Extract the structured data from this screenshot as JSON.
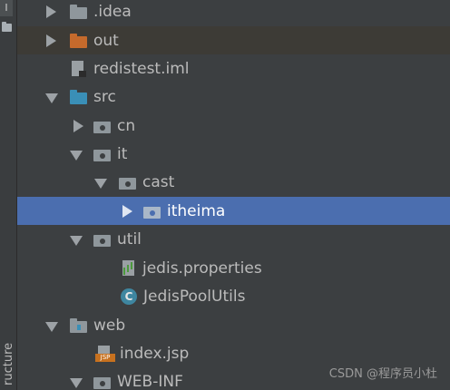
{
  "side": {
    "top_label": "I",
    "structure_tab": "ructure"
  },
  "tree": {
    "items": [
      {
        "label": ".idea"
      },
      {
        "label": "out"
      },
      {
        "label": "redistest.iml"
      },
      {
        "label": "src"
      },
      {
        "label": "cn"
      },
      {
        "label": "it"
      },
      {
        "label": "cast"
      },
      {
        "label": "itheima"
      },
      {
        "label": "util"
      },
      {
        "label": "jedis.properties"
      },
      {
        "label": "JedisPoolUtils"
      },
      {
        "label": "web"
      },
      {
        "label": "index.jsp"
      },
      {
        "label": "WEB-INF"
      }
    ]
  },
  "icons": {
    "class_letter": "C",
    "jsp_badge": "JSP"
  },
  "watermark": "CSDN @程序员小杜",
  "colors": {
    "background": "#3c3f41",
    "selection": "#4b6eaf",
    "out_folder": "#c56a2c",
    "src_folder": "#3a8fb7"
  }
}
